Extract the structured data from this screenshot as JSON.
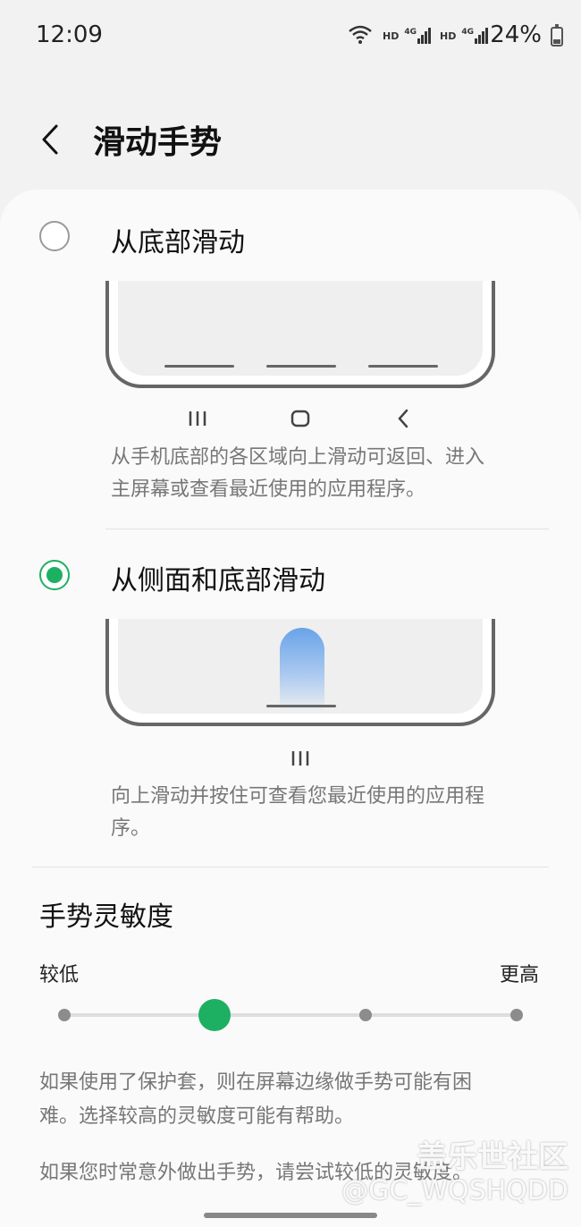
{
  "status_bar": {
    "time": "12:09",
    "network_1": "HD",
    "network_1_type": "4G",
    "network_2": "HD",
    "network_2_type": "4G",
    "battery": "24%",
    "icons": [
      "wifi-icon",
      "signal-icon",
      "signal-icon",
      "battery-charging-icon"
    ]
  },
  "header": {
    "back_icon": "chevron-left-icon",
    "title": "滑动手势"
  },
  "options": [
    {
      "label": "从底部滑动",
      "selected": false,
      "nav_icons": [
        "recents-icon",
        "home-icon",
        "back-icon"
      ],
      "description_line1": "从手机底部的各区域向上滑动可返回、进入",
      "description_line2": "主屏幕或查看最近使用的应用程序。"
    },
    {
      "label": "从侧面和底部滑动",
      "selected": true,
      "nav_icons": [
        "recents-icon"
      ],
      "description_line1": "向上滑动并按住可查看您最近使用的应用程",
      "description_line2": "序。"
    }
  ],
  "sensitivity": {
    "title": "手势灵敏度",
    "low_label": "较低",
    "high_label": "更高",
    "steps": 4,
    "value": 2,
    "note_line1": "如果使用了保护套，则在屏幕边缘做手势可能有困",
    "note_line2": "难。选择较高的灵敏度可能有帮助。",
    "note2_line1": "如果您时常意外做出手势，请尝试较低的灵敏度。"
  },
  "watermark": {
    "line1": "盖乐世社区",
    "line2": "@GC_WQSHQDD"
  },
  "colors": {
    "accent": "#1db063",
    "gesture_blue": "#6aa3e8"
  }
}
